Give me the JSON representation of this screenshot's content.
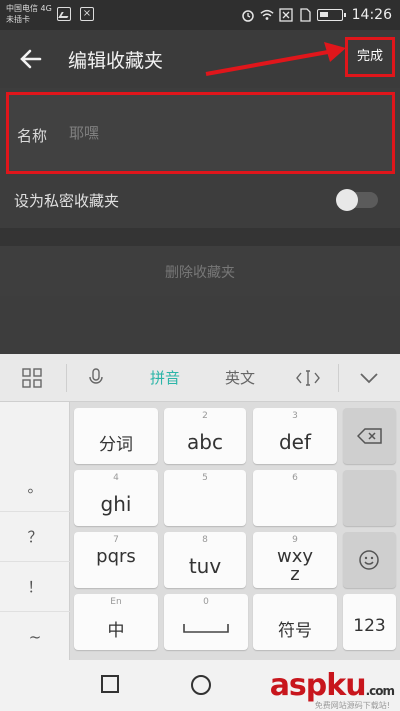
{
  "status_bar": {
    "carrier_line1": "中国电信 4G",
    "carrier_line2": "未插卡",
    "time": "14:26"
  },
  "app_bar": {
    "title": "编辑收藏夹",
    "done_label": "完成",
    "back_icon": "arrow-left-icon"
  },
  "form": {
    "name_label": "名称",
    "name_placeholder": "耶嘿",
    "private_label": "设为私密收藏夹",
    "private_enabled": false,
    "delete_label": "删除收藏夹"
  },
  "keyboard": {
    "toolbar": {
      "grid_icon": "grid-icon",
      "mic_icon": "microphone-icon",
      "pinyin_label": "拼音",
      "english_label": "英文",
      "cursor_icon": "cursor-icon",
      "collapse_icon": "chevron-down-icon"
    },
    "side_keys": [
      "。",
      "？",
      "！",
      "~"
    ],
    "keys": {
      "k1": {
        "num": "",
        "main": "分词"
      },
      "k2": {
        "num": "2",
        "main": "abc"
      },
      "k3": {
        "num": "3",
        "main": "def"
      },
      "k4": {
        "num": "4",
        "main": "ghi"
      },
      "k5": {
        "num": "5",
        "main": ""
      },
      "k6": {
        "num": "6",
        "main": ""
      },
      "k7": {
        "num": "7",
        "main": "pqrs"
      },
      "k8": {
        "num": "8",
        "main": "tuv"
      },
      "k9": {
        "num": "9",
        "main": "wxyz"
      },
      "space_num": "0",
      "lang_num": "En",
      "lang_main": "中",
      "symbol": "符号",
      "num_mode": "123"
    }
  },
  "watermark": {
    "text": "aspku",
    "suffix": ".com",
    "sub": "免费网站源码下载站!"
  },
  "colors": {
    "highlight_red": "#e0161b",
    "accent_teal": "#2cb5a8"
  }
}
